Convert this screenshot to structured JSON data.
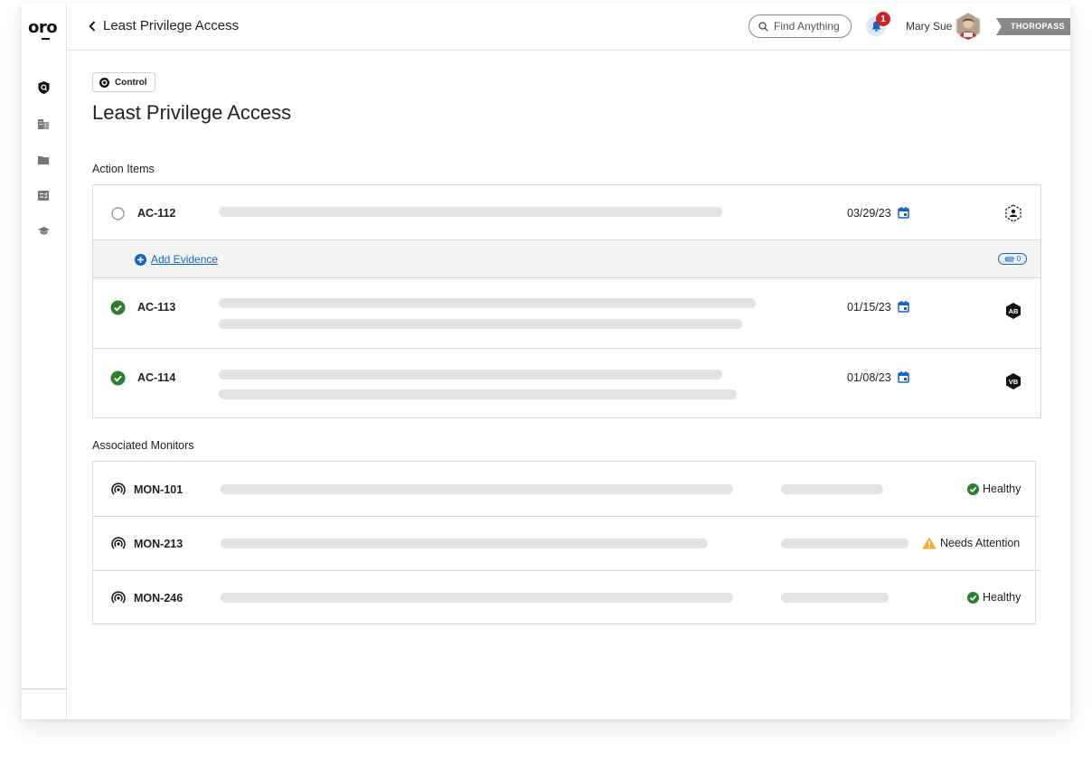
{
  "app": {
    "logo": "oro",
    "brand": "THOROPASS"
  },
  "sidebar": {
    "items": [
      {
        "icon": "shield-search-icon"
      },
      {
        "icon": "building-icon"
      },
      {
        "icon": "folder-icon"
      },
      {
        "icon": "checklist-icon"
      },
      {
        "icon": "graduation-cap-icon"
      }
    ]
  },
  "header": {
    "back_title": "Least Privilege Access",
    "search_placeholder": "Find Anything",
    "notification_count": "1",
    "user_name": "Mary Sue"
  },
  "control": {
    "chip_label": "Control",
    "title": "Least Privilege Access"
  },
  "action_items": {
    "section_title": "Action Items",
    "add_evidence_label": "Add Evidence",
    "attachment_count": "0",
    "items": [
      {
        "id": "AC-112",
        "date": "03/29/23",
        "status": "open",
        "assignee": ""
      },
      {
        "id": "AC-113",
        "date": "01/15/23",
        "status": "done",
        "assignee": "AB"
      },
      {
        "id": "AC-114",
        "date": "01/08/23",
        "status": "done",
        "assignee": "VB"
      }
    ]
  },
  "monitors": {
    "section_title": "Associated Monitors",
    "items": [
      {
        "id": "MON-101",
        "status": "Healthy",
        "status_color": "#2e7d32"
      },
      {
        "id": "MON-213",
        "status": "Needs Attention",
        "status_color": "#f9a825"
      },
      {
        "id": "MON-246",
        "status": "Healthy",
        "status_color": "#2e7d32"
      }
    ]
  },
  "colors": {
    "accent": "#1565c0",
    "success": "#2e7d32",
    "warning": "#f9a825",
    "badge": "#c62828"
  }
}
